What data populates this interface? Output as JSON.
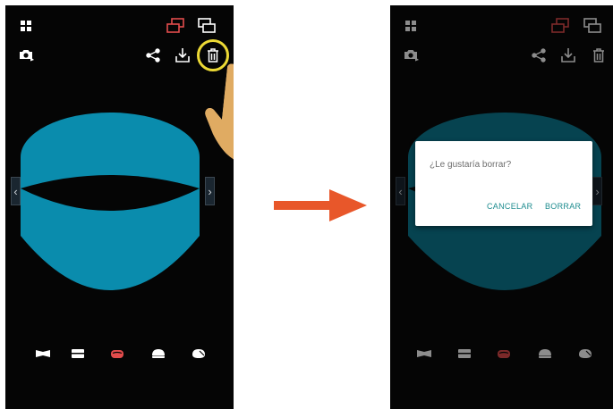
{
  "colors": {
    "bowl": "#0a8cad",
    "bowl_dimmed": "#0c7b93",
    "accent_red": "#e24c4c",
    "hand": "#f0c27e",
    "highlight_ring": "#ecd935",
    "arrow": "#e8572a",
    "dialog_text": "#6d6d6d",
    "dialog_button": "#1e8c8f"
  },
  "toolbar": {
    "icons": [
      "grid-menu-icon",
      "compare-icon",
      "gallery-icon",
      "switch-camera-icon",
      "share-icon",
      "download-icon",
      "trash-icon"
    ]
  },
  "shapes": [
    "shape-bowtie-icon",
    "shape-rectangle-icon",
    "shape-cylinder-icon",
    "shape-dome-icon",
    "shape-round-icon"
  ],
  "nav": {
    "prev": "‹",
    "next": "›"
  },
  "dialog": {
    "message": "¿Le gustaría borrar?",
    "cancel_label": "CANCELAR",
    "confirm_label": "BORRAR"
  }
}
